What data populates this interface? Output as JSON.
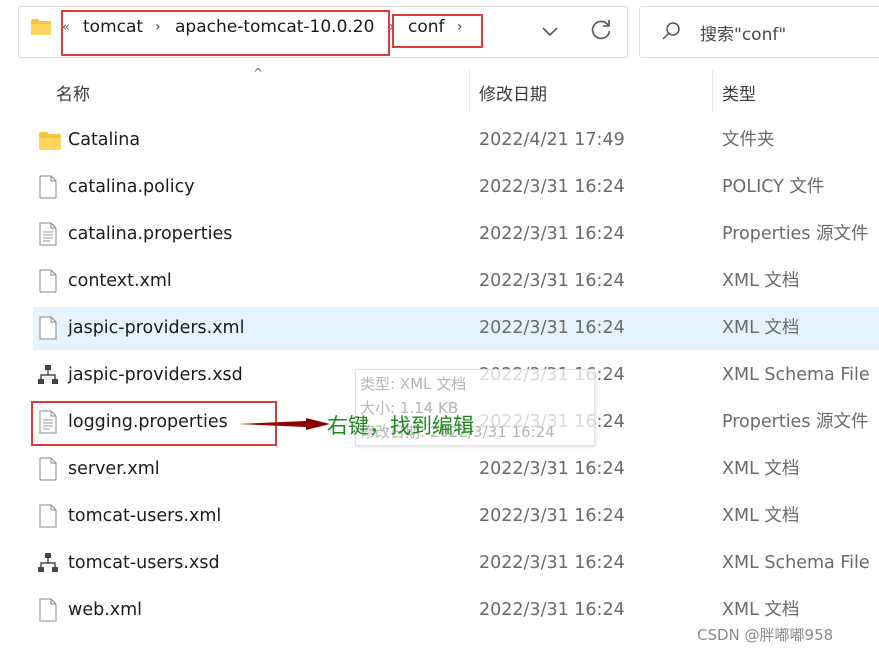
{
  "address_bar": {
    "overflow": "«",
    "crumbs": [
      "tomcat",
      "apache-tomcat-10.0.20",
      "conf"
    ],
    "separator": "›"
  },
  "search": {
    "placeholder": "搜索\"conf\""
  },
  "columns": {
    "name": "名称",
    "date": "修改日期",
    "type": "类型"
  },
  "files": [
    {
      "name": "Catalina",
      "date": "2022/4/21 17:49",
      "type": "文件夹",
      "icon": "folder-icon"
    },
    {
      "name": "catalina.policy",
      "date": "2022/3/31 16:24",
      "type": "POLICY 文件",
      "icon": "file-icon"
    },
    {
      "name": "catalina.properties",
      "date": "2022/3/31 16:24",
      "type": "Properties 源文件",
      "icon": "text-file-icon"
    },
    {
      "name": "context.xml",
      "date": "2022/3/31 16:24",
      "type": "XML 文档",
      "icon": "file-icon"
    },
    {
      "name": "jaspic-providers.xml",
      "date": "2022/3/31 16:24",
      "type": "XML 文档",
      "icon": "file-icon"
    },
    {
      "name": "jaspic-providers.xsd",
      "date": "2022/3/31 16:24",
      "type": "XML Schema File",
      "icon": "schema-file-icon"
    },
    {
      "name": "logging.properties",
      "date": "2022/3/31 16:24",
      "type": "Properties 源文件",
      "icon": "text-file-icon"
    },
    {
      "name": "server.xml",
      "date": "2022/3/31 16:24",
      "type": "XML 文档",
      "icon": "file-icon"
    },
    {
      "name": "tomcat-users.xml",
      "date": "2022/3/31 16:24",
      "type": "XML 文档",
      "icon": "file-icon"
    },
    {
      "name": "tomcat-users.xsd",
      "date": "2022/3/31 16:24",
      "type": "XML Schema File",
      "icon": "schema-file-icon"
    },
    {
      "name": "web.xml",
      "date": "2022/3/31 16:24",
      "type": "XML 文档",
      "icon": "file-icon"
    }
  ],
  "tooltip": {
    "type_line": "类型: XML 文档",
    "size_line": "大小: 1.14 KB",
    "date_line": "修改日期: 2022/3/31 16:24"
  },
  "annotation": {
    "text": "右键，找到编辑",
    "highlight_color": "#e03a3a",
    "text_color": "#1e8a1e",
    "arrow_color": "#8b0000"
  },
  "watermark": "CSDN @胖嘟嘟958"
}
